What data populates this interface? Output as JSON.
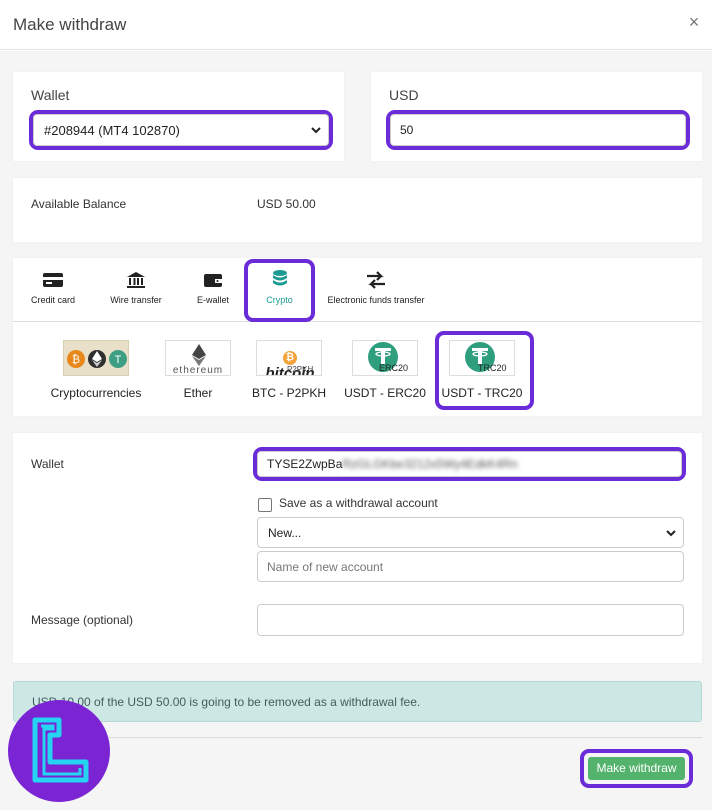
{
  "dialog": {
    "title": "Make withdraw",
    "close_icon": "×"
  },
  "wallet_select": {
    "label": "Wallet",
    "value": "#208944 (MT4 102870)"
  },
  "amount": {
    "label": "USD",
    "value": "50"
  },
  "balance": {
    "label": "Available Balance",
    "value": "USD 50.00"
  },
  "methods": [
    {
      "label": "Credit card",
      "icon": "credit-card-icon"
    },
    {
      "label": "Wire transfer",
      "icon": "bank-icon"
    },
    {
      "label": "E-wallet",
      "icon": "wallet-icon"
    },
    {
      "label": "Crypto",
      "icon": "coins-icon",
      "active": true
    },
    {
      "label": "Electronic funds transfer",
      "icon": "transfer-arrows-icon"
    }
  ],
  "coins": [
    {
      "label": "Cryptocurrencies",
      "logo": "cryptocurrencies-logo"
    },
    {
      "label": "Ether",
      "logo": "ethereum-logo",
      "logo_text": "ethereum"
    },
    {
      "label": "BTC - P2PKH",
      "logo": "bitcoin-logo",
      "logo_text": "bitcoin",
      "logo_sub": "P2PKH"
    },
    {
      "label": "USDT - ERC20",
      "logo": "tether-logo",
      "logo_text": "ERC20"
    },
    {
      "label": "USDT - TRC20",
      "logo": "tether-logo",
      "logo_text": "TRC20",
      "selected": true
    }
  ],
  "withdraw_wallet": {
    "label": "Wallet",
    "value_visible": "TYSE2ZwpBa",
    "value_blurred": "RzGLGKbe3212x5Wy4EdkK4Rn"
  },
  "save_account": {
    "label": "Save as a withdrawal account"
  },
  "account_select": {
    "value": "New..."
  },
  "account_name": {
    "placeholder": "Name of new account"
  },
  "message": {
    "label": "Message (optional)",
    "value": ""
  },
  "fee_notice": "USD 10.00 of the USD 50.00 is going to be removed as a withdrawal fee.",
  "submit": {
    "label": "Make withdraw"
  },
  "colors": {
    "highlight": "#6a2bd9",
    "button": "#53b36c",
    "tab_active": "#1a9a92",
    "alert_bg": "#cde7e5",
    "badge": "#7a24d3"
  }
}
